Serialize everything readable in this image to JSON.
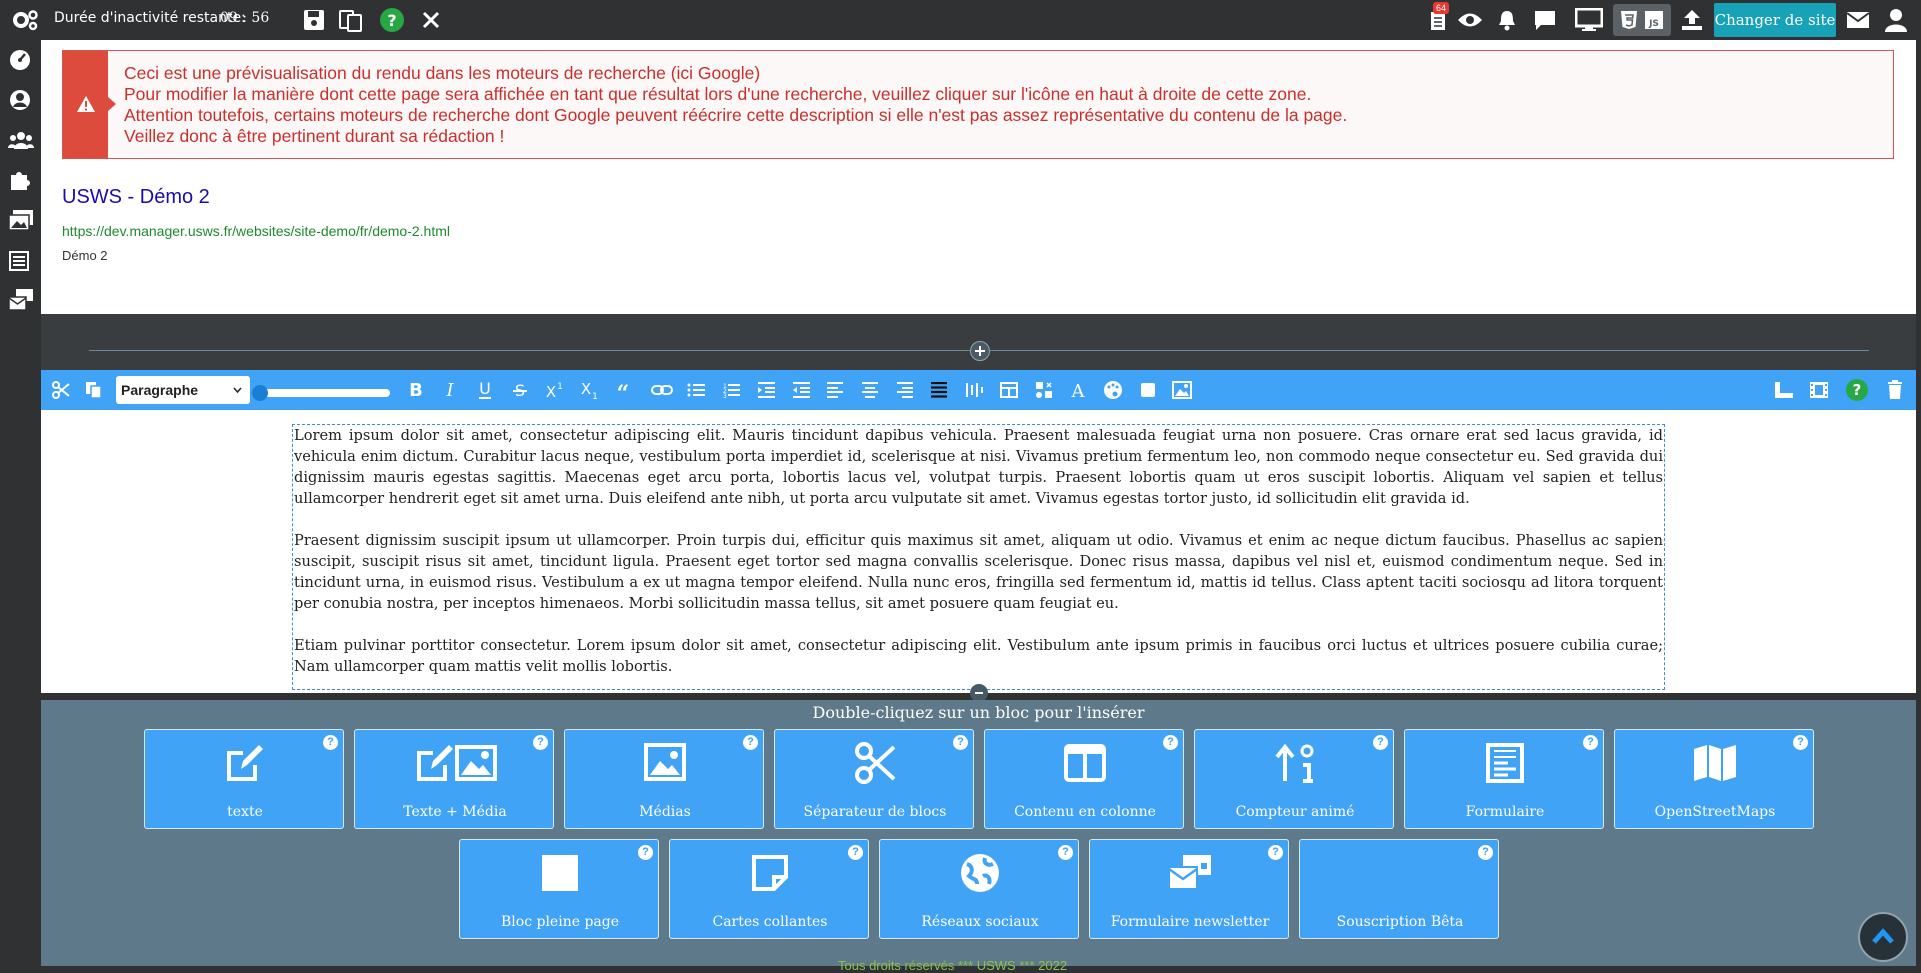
{
  "topbar": {
    "idle_label": "Durée d'inactivité restante:",
    "idle_time": "09 : 56",
    "notification_count": "64",
    "change_site_label": "Changer de site",
    "icons": [
      "gears-icon",
      "save-icon",
      "copy-icon",
      "help-icon",
      "close-icon",
      "task-list-icon",
      "eye-icon",
      "bell-icon",
      "chat-icon",
      "desktop-icon",
      "html5-icon",
      "js-icon",
      "upload-icon",
      "mail-icon",
      "user-icon"
    ]
  },
  "sidebar": {
    "icons": [
      "dashboard-icon",
      "user-circle-icon",
      "users-icon",
      "puzzle-icon",
      "images-icon",
      "list-icon",
      "mail-bulk-icon"
    ]
  },
  "preview": {
    "alert_lines": [
      "Ceci est une prévisualisation du rendu dans les moteurs de recherche (ici Google)",
      "Pour modifier la manière dont cette page sera affichée en tant que résultat lors d'une recherche, veuillez cliquer sur l'icône en haut à droite de cette zone.",
      "Attention toutefois, certains moteurs de recherche dont Google peuvent réécrire cette description si elle n'est pas assez représentative du contenu de la page.",
      "Veillez donc à être pertinent durant sa rédaction !"
    ],
    "title": "USWS - Démo 2",
    "url": "https://dev.manager.usws.fr/websites/site-demo/fr/demo-2.html",
    "description": "Démo 2"
  },
  "toolbar": {
    "format_select": "Paragraphe",
    "slider_level": 0
  },
  "editor": {
    "paragraphs": [
      "Lorem ipsum dolor sit amet, consectetur adipiscing elit. Mauris tincidunt dapibus vehicula. Praesent malesuada feugiat urna non posuere. Cras ornare erat sed lacus gravida, id vehicula enim dictum. Curabitur lacus neque, vestibulum porta imperdiet id, scelerisque at nisi. Vivamus pretium fermentum leo, non commodo neque consectetur eu. Sed gravida dui dignissim mauris egestas sagittis. Maecenas eget arcu porta, lobortis lacus vel, volutpat turpis. Praesent lobortis quam ut eros suscipit lobortis. Aliquam vel sapien et tellus ullamcorper hendrerit eget sit amet urna. Duis eleifend ante nibh, ut porta arcu vulputate sit amet. Vivamus egestas tortor justo, id sollicitudin elit gravida id.",
      "Praesent dignissim suscipit ipsum ut ullamcorper. Proin turpis dui, efficitur quis maximus sit amet, aliquam ut odio. Vivamus et enim ac neque dictum faucibus. Phasellus ac sapien suscipit, suscipit risus sit amet, tincidunt ligula. Praesent eget tortor sed magna convallis scelerisque. Donec risus massa, dapibus vel nisl et, euismod condimentum neque. Sed in tincidunt urna, in euismod risus. Vestibulum a ex ut magna tempor eleifend. Nulla nunc eros, fringilla sed fermentum id, mattis id tellus. Class aptent taciti sociosqu ad litora torquent per conubia nostra, per inceptos himenaeos. Morbi sollicitudin massa tellus, sit amet posuere quam feugiat eu.",
      "Etiam pulvinar porttitor consectetur. Lorem ipsum dolor sit amet, consectetur adipiscing elit. Vestibulum ante ipsum primis in faucibus orci luctus et ultrices posuere cubilia curae; Nam ullamcorper quam mattis velit mollis lobortis."
    ]
  },
  "blocks": {
    "hint": "Double-cliquez sur un bloc pour l'insérer",
    "row1": [
      {
        "label": "texte",
        "icon": "edit-icon"
      },
      {
        "label": "Texte + Média",
        "icon": "edit-image-icon"
      },
      {
        "label": "Médias",
        "icon": "image-icon"
      },
      {
        "label": "Séparateur de blocs",
        "icon": "scissors-icon"
      },
      {
        "label": "Contenu en colonne",
        "icon": "columns-icon"
      },
      {
        "label": "Compteur animé",
        "icon": "counter-icon"
      },
      {
        "label": "Formulaire",
        "icon": "form-icon"
      },
      {
        "label": "OpenStreetMaps",
        "icon": "map-icon"
      }
    ],
    "row2": [
      {
        "label": "Bloc pleine page",
        "icon": "square-icon"
      },
      {
        "label": "Cartes collantes",
        "icon": "sticky-note-icon"
      },
      {
        "label": "Réseaux sociaux",
        "icon": "globe-icon"
      },
      {
        "label": "Formulaire newsletter",
        "icon": "mail-bulk-icon"
      },
      {
        "label": "Souscription Bêta",
        "icon": "blank-icon"
      }
    ]
  },
  "footer": {
    "text": "Tous droits réservés *** USWS *** 2022"
  },
  "colors": {
    "accent": "#41a3f5",
    "alert": "#dc4b3c",
    "button": "#17a2b8"
  }
}
